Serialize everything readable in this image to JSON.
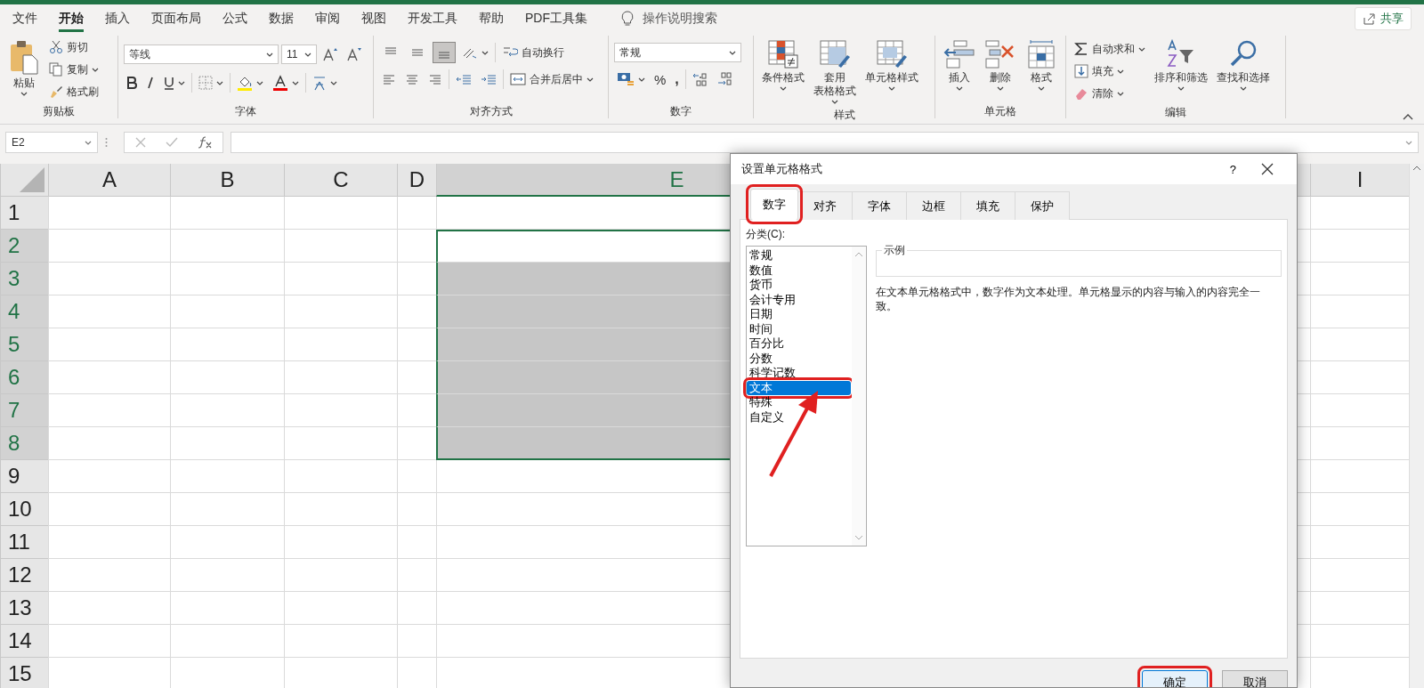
{
  "menu_tabs": [
    {
      "label": "文件",
      "selected": false
    },
    {
      "label": "开始",
      "selected": true
    },
    {
      "label": "插入",
      "selected": false
    },
    {
      "label": "页面布局",
      "selected": false
    },
    {
      "label": "公式",
      "selected": false
    },
    {
      "label": "数据",
      "selected": false
    },
    {
      "label": "审阅",
      "selected": false
    },
    {
      "label": "视图",
      "selected": false
    },
    {
      "label": "开发工具",
      "selected": false
    },
    {
      "label": "帮助",
      "selected": false
    },
    {
      "label": "PDF工具集",
      "selected": false
    }
  ],
  "tell_me": {
    "placeholder": "操作说明搜索"
  },
  "share_button": "共享",
  "ribbon": {
    "clipboard": {
      "label": "剪贴板",
      "paste": "粘贴",
      "cut": "剪切",
      "copy": "复制",
      "format_painter": "格式刷"
    },
    "font": {
      "label": "字体",
      "font_name": "等线",
      "font_size": "11"
    },
    "alignment": {
      "label": "对齐方式",
      "vertical_align": [
        {
          "selected": false
        },
        {
          "selected": false
        },
        {
          "selected": true
        }
      ],
      "wrap_text": "自动换行",
      "merge_center": "合并后居中"
    },
    "number": {
      "label": "数字",
      "format": "常规",
      "percent": "%",
      "comma": ","
    },
    "styles": {
      "label": "样式",
      "conditional": "条件格式",
      "format_as_table": [
        "套用",
        "表格格式"
      ],
      "cell_styles": "单元格样式"
    },
    "cells": {
      "label": "单元格",
      "insert": "插入",
      "delete": "删除",
      "format": "格式"
    },
    "editing": {
      "label": "编辑",
      "autosum": "自动求和",
      "fill": "填充",
      "clear": "清除",
      "sort_filter": "排序和筛选",
      "find_select": "查找和选择"
    }
  },
  "formula_bar": {
    "name_box": "E2"
  },
  "sheet": {
    "columns": [
      {
        "label": "A",
        "selected": false
      },
      {
        "label": "B",
        "selected": false
      },
      {
        "label": "C",
        "selected": false
      },
      {
        "label": "D",
        "selected": false
      },
      {
        "label": "E",
        "selected": true
      },
      {
        "label": "I",
        "selected": false
      }
    ],
    "rows": [
      {
        "label": "1",
        "selected": false
      },
      {
        "label": "2",
        "selected": true
      },
      {
        "label": "3",
        "selected": true
      },
      {
        "label": "4",
        "selected": true
      },
      {
        "label": "5",
        "selected": true
      },
      {
        "label": "6",
        "selected": true
      },
      {
        "label": "7",
        "selected": true
      },
      {
        "label": "8",
        "selected": true
      },
      {
        "label": "9",
        "selected": false
      },
      {
        "label": "10",
        "selected": false
      },
      {
        "label": "11",
        "selected": false
      },
      {
        "label": "12",
        "selected": false
      },
      {
        "label": "13",
        "selected": false
      },
      {
        "label": "14",
        "selected": false
      },
      {
        "label": "15",
        "selected": false
      }
    ]
  },
  "dialog": {
    "title": "设置单元格格式",
    "help": "?",
    "tabs": [
      {
        "label": "数字",
        "selected": true,
        "highlighted": true
      },
      {
        "label": "对齐",
        "selected": false,
        "highlighted": false
      },
      {
        "label": "字体",
        "selected": false,
        "highlighted": false
      },
      {
        "label": "边框",
        "selected": false,
        "highlighted": false
      },
      {
        "label": "填充",
        "selected": false,
        "highlighted": false
      },
      {
        "label": "保护",
        "selected": false,
        "highlighted": false
      }
    ],
    "category_label": "分类(C):",
    "categories": [
      {
        "label": "常规",
        "selected": false,
        "highlighted": false
      },
      {
        "label": "数值",
        "selected": false,
        "highlighted": false
      },
      {
        "label": "货币",
        "selected": false,
        "highlighted": false
      },
      {
        "label": "会计专用",
        "selected": false,
        "highlighted": false
      },
      {
        "label": "日期",
        "selected": false,
        "highlighted": false
      },
      {
        "label": "时间",
        "selected": false,
        "highlighted": false
      },
      {
        "label": "百分比",
        "selected": false,
        "highlighted": false
      },
      {
        "label": "分数",
        "selected": false,
        "highlighted": false
      },
      {
        "label": "科学记数",
        "selected": false,
        "highlighted": false
      },
      {
        "label": "文本",
        "selected": true,
        "highlighted": true
      },
      {
        "label": "特殊",
        "selected": false,
        "highlighted": false
      },
      {
        "label": "自定义",
        "selected": false,
        "highlighted": false
      }
    ],
    "sample_label": "示例",
    "description": "在文本单元格格式中，数字作为文本处理。单元格显示的内容与输入的内容完全一致。",
    "buttons": [
      {
        "label": "确定",
        "default": true,
        "highlighted": true
      },
      {
        "label": "取消",
        "default": false,
        "highlighted": false
      }
    ]
  }
}
